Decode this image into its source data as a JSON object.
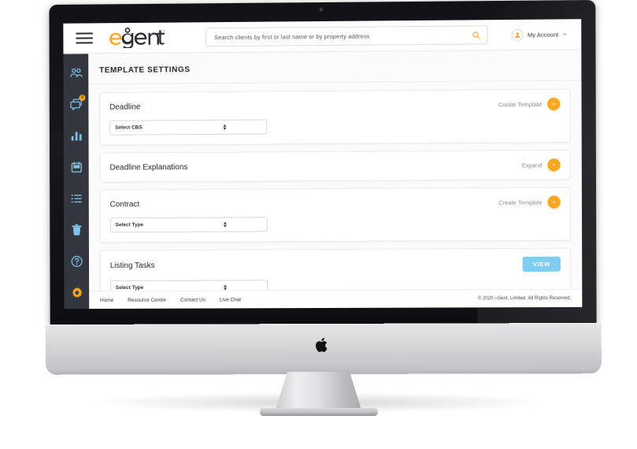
{
  "device": {
    "type": "imac-desktop-monitor",
    "brand_logo": "apple-logo"
  },
  "topbar": {
    "menu_icon": "hamburger-menu-icon",
    "logo": {
      "text": "egent",
      "accent_letter": "e",
      "trademark": "™",
      "accent_color": "#f5a623",
      "text_color": "#2b2b30"
    },
    "search": {
      "placeholder": "Search clients by first or last name or by property address",
      "value": "",
      "icon": "search-icon",
      "icon_color": "#f5a623"
    },
    "account": {
      "label": "My Account",
      "avatar_icon": "user-avatar-icon",
      "caret_icon": "chevron-down-icon"
    }
  },
  "sidebar": {
    "background": "#33363d",
    "items": [
      {
        "name": "clients",
        "icon": "people-group-icon",
        "badge": null,
        "active": false
      },
      {
        "name": "messages",
        "icon": "chat-bubbles-icon",
        "badge": "0",
        "active": false
      },
      {
        "name": "reports",
        "icon": "bar-chart-icon",
        "badge": null,
        "active": false
      },
      {
        "name": "calendar",
        "icon": "calendar-icon",
        "badge": null,
        "active": false
      },
      {
        "name": "tasks",
        "icon": "list-icon",
        "badge": null,
        "active": false
      },
      {
        "name": "trash",
        "icon": "trash-icon",
        "badge": null,
        "active": false
      },
      {
        "name": "help",
        "icon": "question-mark-icon",
        "badge": null,
        "active": false
      },
      {
        "name": "settings",
        "icon": "gear-icon",
        "badge": null,
        "active": true
      }
    ]
  },
  "main": {
    "page_title": "TEMPLATE SETTINGS",
    "cards": [
      {
        "title": "Deadline",
        "action_text": "Create Template",
        "action_button": "plus-button",
        "select": {
          "value": "Select CBS",
          "placeholder": "Select CBS"
        }
      },
      {
        "title": "Deadline Explanations",
        "action_text": "Expand",
        "action_button": "plus-button",
        "select": null
      },
      {
        "title": "Contract",
        "action_text": "Create Template",
        "action_button": "plus-button",
        "select": {
          "value": "Select Type",
          "placeholder": "Select Type"
        }
      },
      {
        "title": "Listing Tasks",
        "action_text": "",
        "action_button": "view-button",
        "view_label": "VIEW",
        "select": {
          "value": "Select Type",
          "placeholder": "Select Type"
        }
      }
    ]
  },
  "footer": {
    "links": [
      "Home",
      "Resource Center",
      "Contact Us",
      "Live Chat"
    ],
    "copyright_prefix": "© 2020 ",
    "copyright_brand_accent": "e",
    "copyright_suffix": "Gent, Limited.  All Rights Reserved."
  },
  "colors": {
    "accent_orange": "#f5a623",
    "accent_blue": "#7fcdf0",
    "sidebar_icon_blue": "#7fc3e8",
    "dark_panel": "#33363d"
  }
}
